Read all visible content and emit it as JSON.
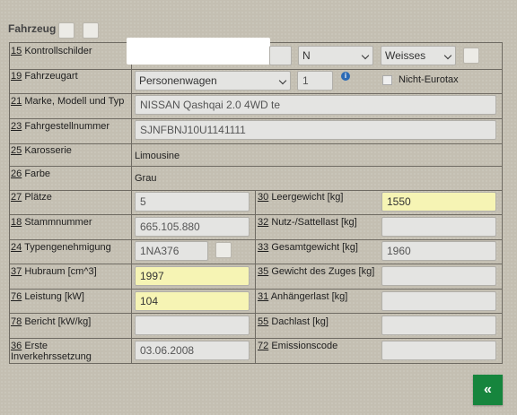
{
  "section": {
    "title": "Fahrzeug"
  },
  "rows": {
    "kontrollschilder": {
      "code": "15",
      "label": "Kontrollschilder",
      "number": "",
      "kind": "N",
      "color": "Weisses"
    },
    "fahrzeugart": {
      "code": "19",
      "label": "Fahrzeugart",
      "value": "Personenwagen",
      "count": "1",
      "nicht_eurotax": "Nicht-Eurotax"
    },
    "marke": {
      "code": "21",
      "label": "Marke, Modell und Typ",
      "value": "NISSAN Qashqai 2.0 4WD te"
    },
    "fahrgestell": {
      "code": "23",
      "label": "Fahrgestellnummer",
      "value": "SJNFBNJ10U1141111"
    },
    "karosserie": {
      "code": "25",
      "label": "Karosserie",
      "value": "Limousine"
    },
    "farbe": {
      "code": "26",
      "label": "Farbe",
      "value": "Grau"
    },
    "plaetze": {
      "code": "27",
      "label": "Plätze",
      "value": "5"
    },
    "leergewicht": {
      "code": "30",
      "label": "Leergewicht [kg]",
      "value": "1550"
    },
    "stammnummer": {
      "code": "18",
      "label": "Stammnummer",
      "value": "665.105.880"
    },
    "nutzlast": {
      "code": "32",
      "label": "Nutz-/Sattellast [kg]",
      "value": ""
    },
    "typengenehmigung": {
      "code": "24",
      "label": "Typengenehmigung",
      "value": "1NA376"
    },
    "gesamtgewicht": {
      "code": "33",
      "label": "Gesamtgewicht [kg]",
      "value": "1960"
    },
    "hubraum": {
      "code": "37",
      "label": "Hubraum [cm^3]",
      "value": "1997"
    },
    "zugesgewicht": {
      "code": "35",
      "label": "Gewicht des Zuges [kg]",
      "value": ""
    },
    "leistung": {
      "code": "76",
      "label": "Leistung [kW]",
      "value": "104"
    },
    "anhaengerlast": {
      "code": "31",
      "label": "Anhängerlast [kg]",
      "value": ""
    },
    "bericht": {
      "code": "78",
      "label": "Bericht [kW/kg]",
      "value": ""
    },
    "dachlast": {
      "code": "55",
      "label": "Dachlast [kg]",
      "value": ""
    },
    "inverkehr": {
      "code": "36",
      "label_line1": "Erste",
      "label_line2": "Inverkehrssetzung",
      "value": "03.06.2008"
    },
    "emission": {
      "code": "72",
      "label": "Emissionscode",
      "value": ""
    }
  },
  "back_button": {
    "label": "«"
  }
}
